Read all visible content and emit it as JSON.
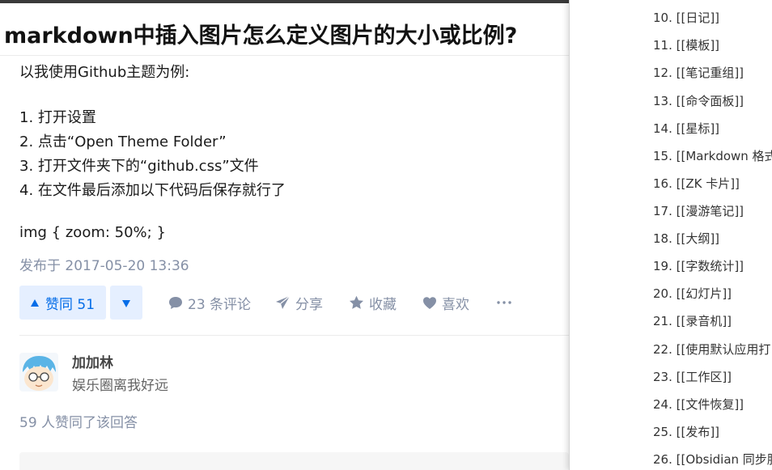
{
  "answer": {
    "title": "markdown中插入图片怎么定义图片的大小或比例?",
    "intro": "以我使用Github主题为例:",
    "steps": [
      "1. 打开设置",
      "2. 点击“Open Theme Folder”",
      "3. 打开文件夹下的“github.css”文件",
      "4. 在文件最后添加以下代码后保存就行了"
    ],
    "code": "img { zoom: 50%; }",
    "published": "发布于 2017-05-20 13:36"
  },
  "actions": {
    "upvote_label": "赞同 51",
    "comments_label": "23 条评论",
    "share_label": "分享",
    "favorite_label": "收藏",
    "like_label": "喜欢",
    "more_icon": "more-icon",
    "accent_color": "#056de8",
    "accent_bg": "#e5efff"
  },
  "author": {
    "name": "加加林",
    "bio": "娱乐圈离我好远",
    "upvoted_text": "59 人赞同了该回答"
  },
  "outline": {
    "items": [
      "10. [[日记]]",
      "11. [[模板]]",
      "12. [[笔记重组]]",
      "13. [[命令面板]]",
      "14. [[星标]]",
      "15. [[Markdown 格式",
      "16. [[ZK 卡片]]",
      "17. [[漫游笔记]]",
      "18. [[大纲]]",
      "19. [[字数统计]]",
      "20. [[幻灯片]]",
      "21. [[录音机]]",
      "22. [[使用默认应用打",
      "23. [[工作区]]",
      "24. [[文件恢复]]",
      "25. [[发布]]",
      "26. [[Obsidian 同步服"
    ]
  }
}
